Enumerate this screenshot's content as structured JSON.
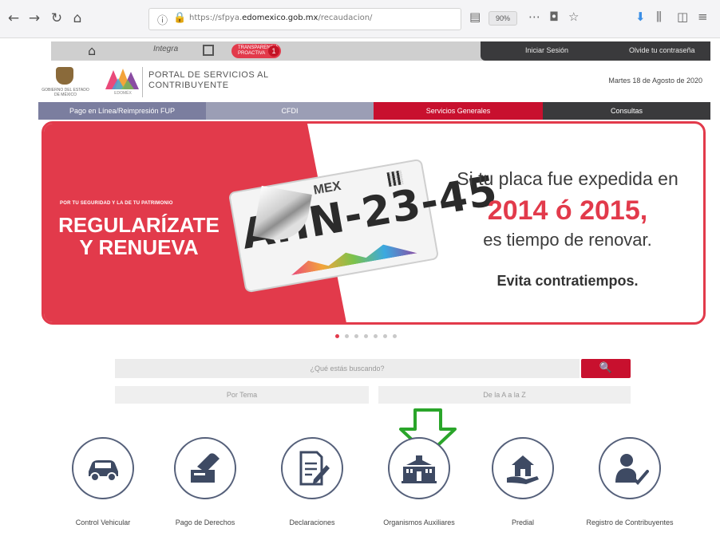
{
  "browser": {
    "url_prefix": "https://sfpya.",
    "url_domain": "edomexico.gob.mx",
    "url_path": "/recaudacion/",
    "zoom": "90%"
  },
  "topbar": {
    "logo_small": "Integra",
    "pill_text": "TRANSPARENCIA PROACTIVA",
    "pill_count": "1",
    "login": "Iniciar Sesión",
    "password": "Olvide tu contraseña"
  },
  "header": {
    "emblem_label": "GOBIERNO DEL ESTADO DE MÉXICO",
    "logo_sub": "EDOMÉX",
    "portal_title_line1": "PORTAL DE SERVICIOS AL",
    "portal_title_line2": "CONTRIBUYENTE",
    "date": "Martes 18 de Agosto de 2020"
  },
  "menu": [
    {
      "label": "Pago en Línea/Reimpresión FUP",
      "color": "#7b7e9f"
    },
    {
      "label": "CFDI",
      "color": "#9b9eb5"
    },
    {
      "label": "Servicios Generales",
      "color": "#c8102e"
    },
    {
      "label": "Consultas",
      "color": "#3a3a3c"
    }
  ],
  "banner": {
    "small": "POR TU SEGURIDAD Y LA DE TU PATRIMONIO",
    "headline": "REGULARÍZATE Y RENUEVA",
    "plate_number": "AHN-23-45",
    "plate_state": "MEX",
    "line1": "Si tu placa fue expedida en",
    "line2": "2014 ó 2015,",
    "line3": "es tiempo de renovar.",
    "line4": "Evita contratiempos.",
    "accent": "#e23a4b"
  },
  "carousel": {
    "count": 7,
    "active": 0
  },
  "search": {
    "placeholder": "¿Qué estás buscando?",
    "filter_theme": "Por Tema",
    "filter_az": "De la A a la Z"
  },
  "services": [
    {
      "label": "Control Vehicular",
      "icon": "car-icon"
    },
    {
      "label": "Pago de Derechos",
      "icon": "payment-hand-icon"
    },
    {
      "label": "Declaraciones",
      "icon": "document-pen-icon"
    },
    {
      "label": "Organismos Auxiliares",
      "icon": "government-building-icon"
    },
    {
      "label": "Predial",
      "icon": "house-hand-icon"
    },
    {
      "label": "Registro de Contribuyentes",
      "icon": "user-check-icon"
    }
  ]
}
